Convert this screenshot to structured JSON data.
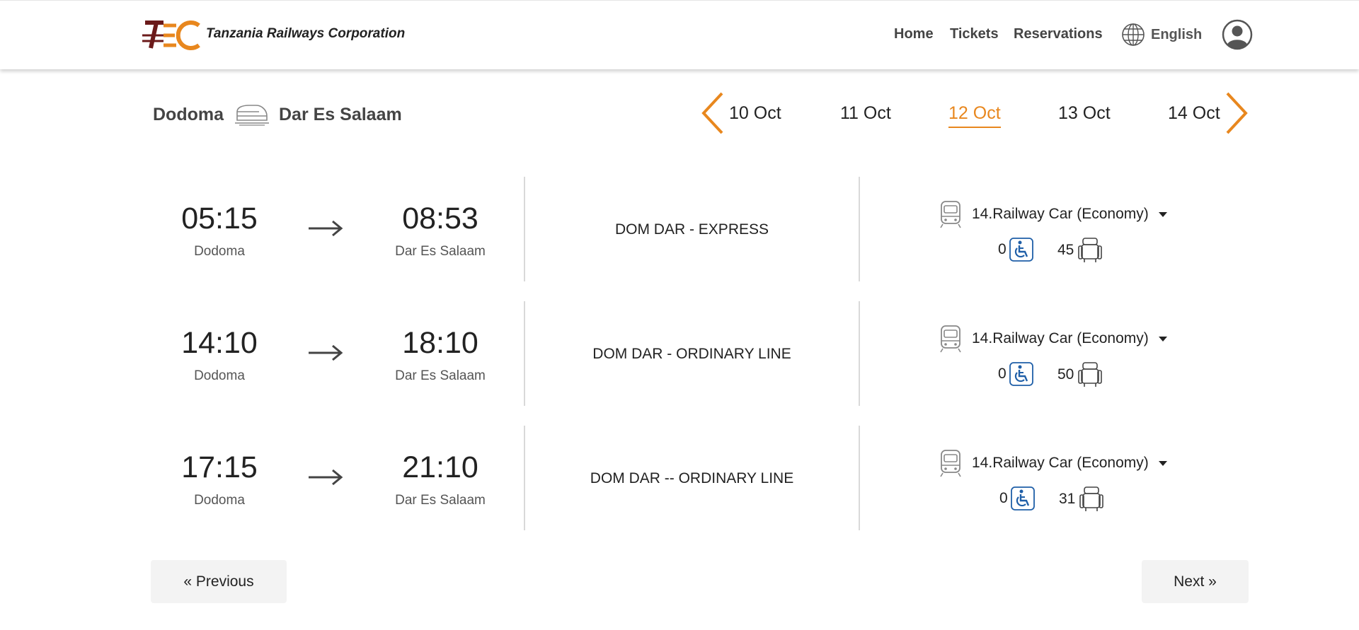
{
  "header": {
    "logo_text": "TRC",
    "brand": "Tanzania Railways Corporation",
    "nav": {
      "home": "Home",
      "tickets": "Tickets",
      "reservations": "Reservations"
    },
    "language": "English"
  },
  "route": {
    "from": "Dodoma",
    "to": "Dar Es Salaam"
  },
  "dates": {
    "items": [
      "10 Oct",
      "11 Oct",
      "12 Oct",
      "13 Oct",
      "14 Oct"
    ],
    "selected": "12 Oct"
  },
  "trips": [
    {
      "departure_time": "05:15",
      "departure_city": "Dodoma",
      "arrival_time": "08:53",
      "arrival_city": "Dar Es Salaam",
      "service": "DOM DAR - EXPRESS",
      "car": "14.Railway Car (Economy)",
      "accessible_seats": "0",
      "seats": "45"
    },
    {
      "departure_time": "14:10",
      "departure_city": "Dodoma",
      "arrival_time": "18:10",
      "arrival_city": "Dar Es Salaam",
      "service": "DOM DAR - ORDINARY LINE",
      "car": "14.Railway Car (Economy)",
      "accessible_seats": "0",
      "seats": "50"
    },
    {
      "departure_time": "17:15",
      "departure_city": "Dodoma",
      "arrival_time": "21:10",
      "arrival_city": "Dar Es Salaam",
      "service": "DOM DAR -- ORDINARY LINE",
      "car": "14.Railway Car (Economy)",
      "accessible_seats": "0",
      "seats": "31"
    }
  ],
  "pagination": {
    "previous": "« Previous",
    "next": "Next »"
  },
  "colors": {
    "accent": "#e8871e",
    "brand_dark": "#6b1a1a",
    "wheelchair_blue": "#1f5fa8"
  }
}
